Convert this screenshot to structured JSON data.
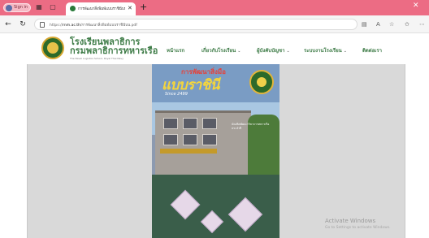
{
  "browser": {
    "profile_label": "Sign in",
    "tab_title": "การพัฒนาสิ่งพิมพ์แบบราชินีบน",
    "url_domain": "rnm.ac.th",
    "url_prefix": "https://",
    "url_rest": "/การพัฒนาสิ่งพิมพ์แบบราชินีบน.pdf",
    "zoom_icon": "A"
  },
  "site": {
    "school_name": "โรงเรียนพลาธิการ",
    "dept_name": "กรมพลาธิการทหารเรือ",
    "tagline": "The Naval Logistics School, Royal Thai Navy",
    "menu": [
      {
        "label": "หน้าแรก",
        "has_dropdown": false
      },
      {
        "label": "เกี่ยวกับโรงเรียน",
        "has_dropdown": true
      },
      {
        "label": "ผู้บังคับบัญชา",
        "has_dropdown": true
      },
      {
        "label": "ระบบงานโรงเรียน",
        "has_dropdown": true
      },
      {
        "label": "ติดต่อเรา",
        "has_dropdown": false
      }
    ]
  },
  "cover": {
    "title_line1": "การพัฒนาสิ่งมือ",
    "title_line2": "แบบราชินี",
    "since": "Since 2499",
    "side_text": "บัณฑิตพัฒนาวิชาการทหารเรือ ประจำปี",
    "banner": "อาคารเรียน"
  },
  "watermark": {
    "line1": "Activate Windows",
    "line2": "Go to Settings to activate Windows."
  },
  "colors": {
    "tab_bar": "#ec6c84",
    "brand_green": "#3d7b46",
    "content_bg": "#d9d9d9"
  }
}
